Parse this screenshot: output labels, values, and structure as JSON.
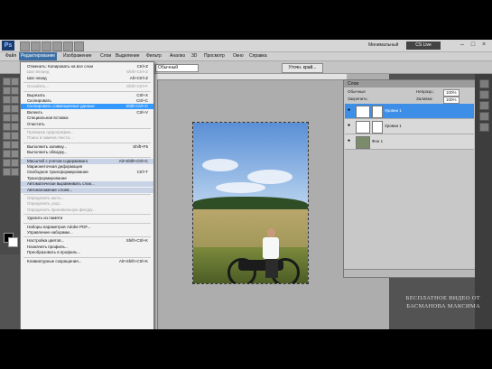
{
  "app": {
    "logo": "Ps",
    "workspace": "Минимальный",
    "cs_live": "CS Live"
  },
  "menubar": [
    "Файл",
    "Редактирование",
    "Изображение",
    "Слои",
    "Выделение",
    "Фильтр",
    "Анализ",
    "3D",
    "Просмотр",
    "Окно",
    "Справка"
  ],
  "options": {
    "style_value": "Обычный",
    "refine_button": "Уточн. край..."
  },
  "edit_menu": [
    {
      "label": "Отменить: Копировать на все слои",
      "shortcut": "Ctrl+Z",
      "state": "normal"
    },
    {
      "label": "Шаг вперед",
      "shortcut": "Shift+Ctrl+Z",
      "state": "disabled"
    },
    {
      "label": "Шаг назад",
      "shortcut": "Alt+Ctrl+Z",
      "state": "normal"
    },
    {
      "sep": true
    },
    {
      "label": "Ослабить...",
      "shortcut": "Shift+Ctrl+F",
      "state": "disabled"
    },
    {
      "sep": true
    },
    {
      "label": "Вырезать",
      "shortcut": "Ctrl+X",
      "state": "normal"
    },
    {
      "label": "Скопировать",
      "shortcut": "Ctrl+C",
      "state": "normal"
    },
    {
      "label": "Скопировать совмещенные данные",
      "shortcut": "Shift+Ctrl+C",
      "state": "highlight"
    },
    {
      "label": "Вклеить",
      "shortcut": "Ctrl+V",
      "state": "normal"
    },
    {
      "label": "Специальная вставка",
      "shortcut": "",
      "state": "normal"
    },
    {
      "label": "Очистить",
      "shortcut": "",
      "state": "normal"
    },
    {
      "sep": true
    },
    {
      "label": "Проверка орфографии...",
      "shortcut": "",
      "state": "disabled"
    },
    {
      "label": "Поиск и замена текста...",
      "shortcut": "",
      "state": "disabled"
    },
    {
      "sep": true
    },
    {
      "label": "Выполнить заливку...",
      "shortcut": "Shift+F5",
      "state": "normal"
    },
    {
      "label": "Выполнить обводку...",
      "shortcut": "",
      "state": "normal"
    },
    {
      "sep": true
    },
    {
      "label": "Масштаб с учетом содержимого",
      "shortcut": "Alt+Shift+Ctrl+C",
      "state": "hl2"
    },
    {
      "label": "Марионеточная деформация",
      "shortcut": "",
      "state": "normal"
    },
    {
      "label": "Свободное трансформирование",
      "shortcut": "Ctrl+T",
      "state": "normal"
    },
    {
      "label": "Трансформирование",
      "shortcut": "",
      "state": "normal"
    },
    {
      "label": "Автоматически выравнивать слои...",
      "shortcut": "",
      "state": "hl2"
    },
    {
      "label": "Автоналожение слоев...",
      "shortcut": "",
      "state": "hl2"
    },
    {
      "sep": true
    },
    {
      "label": "Определить кисть...",
      "shortcut": "",
      "state": "disabled"
    },
    {
      "label": "Определить узор...",
      "shortcut": "",
      "state": "disabled"
    },
    {
      "label": "Определить произвольную фигуру...",
      "shortcut": "",
      "state": "disabled"
    },
    {
      "sep": true
    },
    {
      "label": "Удалить из памяти",
      "shortcut": "",
      "state": "normal"
    },
    {
      "sep": true
    },
    {
      "label": "Наборы параметров Adobe PDF...",
      "shortcut": "",
      "state": "normal"
    },
    {
      "label": "Управление наборами...",
      "shortcut": "",
      "state": "normal"
    },
    {
      "sep": true
    },
    {
      "label": "Настройка цветов...",
      "shortcut": "Shift+Ctrl+K",
      "state": "normal"
    },
    {
      "label": "Назначить профиль...",
      "shortcut": "",
      "state": "normal"
    },
    {
      "label": "Преобразовать в профиль...",
      "shortcut": "",
      "state": "normal"
    },
    {
      "sep": true
    },
    {
      "label": "Клавиатурные сокращения...",
      "shortcut": "Alt+Shift+Ctrl+K",
      "state": "normal"
    }
  ],
  "layers_panel": {
    "title": "Слои",
    "mode": "Обычные",
    "opacity_label": "Непрозр.:",
    "opacity_value": "100%",
    "lock_label": "Закрепить:",
    "fill_label": "Заливка:",
    "fill_value": "100%",
    "layers": [
      {
        "name": "Уровни 1",
        "selected": true
      },
      {
        "name": "Уровни 1",
        "selected": false
      },
      {
        "name": "Фон 1",
        "selected": false
      }
    ]
  },
  "watermark": {
    "line1": "БЕСПЛАТНОЕ ВИДЕО ОТ",
    "line2": "БАСМАНОВА МАКСИМА"
  },
  "colors": {
    "highlight": "#3399ff",
    "selected_layer": "#3d8ee6",
    "menu_bg": "#f2f2f2"
  }
}
